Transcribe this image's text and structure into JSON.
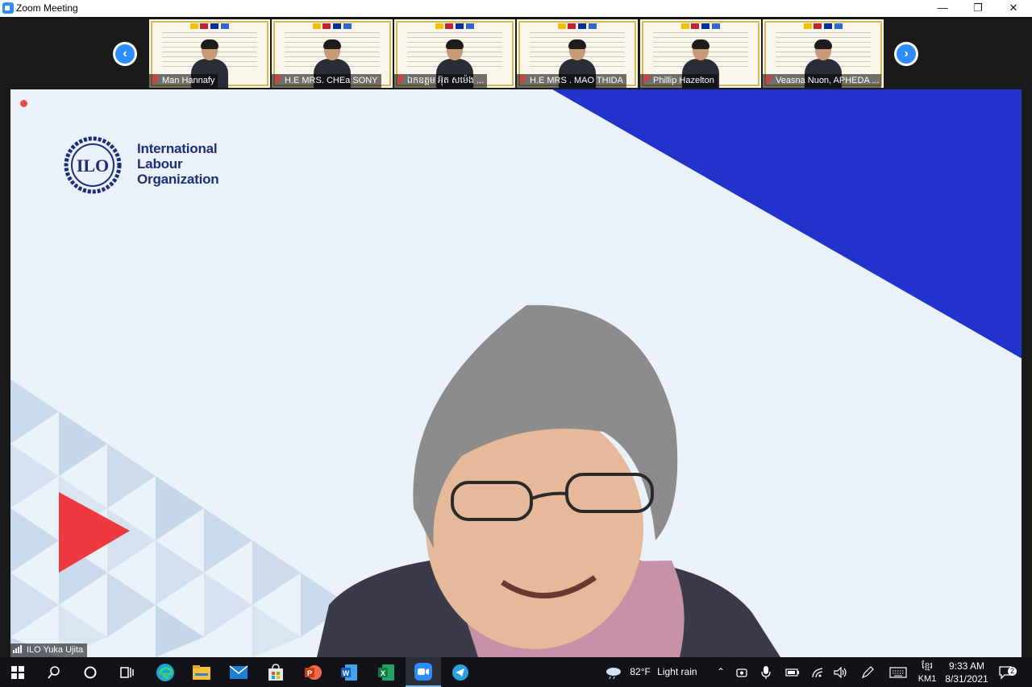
{
  "window": {
    "title": "Zoom Meeting",
    "minimize_glyph": "—",
    "maximize_glyph": "❐",
    "close_glyph": "✕"
  },
  "gallery": {
    "prev_glyph": "‹",
    "next_glyph": "›",
    "participants": [
      {
        "name": "Man Hannafy",
        "muted": true
      },
      {
        "name": "H.E MRS. CHEa SONY",
        "muted": true
      },
      {
        "name": "ឯកឧត្តម អ៊ុត សម៉េង ...",
        "muted": true
      },
      {
        "name": "H.E MRS . MAO THIDA",
        "muted": true
      },
      {
        "name": "Phillip Hazelton",
        "muted": true
      },
      {
        "name": "Veasna Nuon, APHEDA ...",
        "muted": true
      }
    ]
  },
  "main_video": {
    "recording_label": "Recording...",
    "logo_lines": [
      "International",
      "Labour",
      "Organization"
    ],
    "logo_abbr": "ILO",
    "speaker_name": "ILO Yuka Ujita",
    "colors": {
      "background": "#eaf1f9",
      "blue_band": "#2233cc",
      "triangle_light": "#c5d6ea",
      "triangle_red": "#ee3a3f",
      "logo_blue": "#1e2d78"
    }
  },
  "taskbar": {
    "pinned": [
      "windows-start-icon",
      "search-icon",
      "cortana-icon",
      "task-view-icon",
      "edge-icon",
      "file-explorer-icon",
      "mail-icon",
      "store-icon",
      "powerpoint-icon",
      "word-icon",
      "excel-icon",
      "zoom-icon",
      "telegram-icon"
    ],
    "weather_temp": "82°F",
    "weather_text": "Light rain",
    "lang_top": "ខ្មែរ",
    "lang_bottom": "KM1",
    "time": "9:33 AM",
    "date": "8/31/2021",
    "notification_count": "2"
  }
}
